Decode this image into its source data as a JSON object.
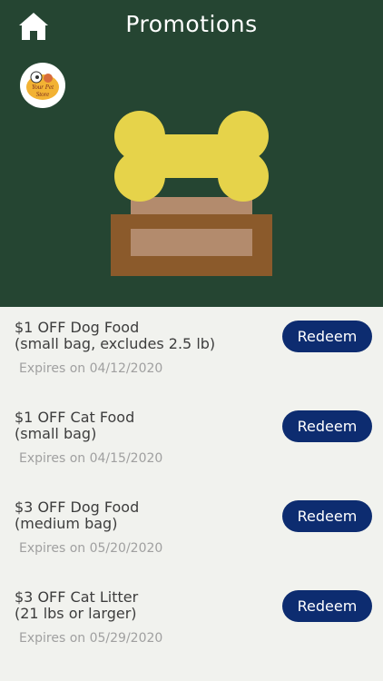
{
  "header": {
    "title": "Promotions",
    "home_icon": "home-icon",
    "logo_text": "Your Pet Store",
    "hero_image": "dog-bone-box",
    "colors": {
      "background": "#254532",
      "bone": "#e6d34a",
      "box": "#8b5a2b",
      "box_inner": "#b38b6d"
    }
  },
  "promotions": [
    {
      "title": "$1 OFF Dog Food\n(small bag, excludes 2.5 lb)",
      "expires": "Expires on 04/12/2020",
      "button": "Redeem"
    },
    {
      "title": "$1 OFF Cat Food\n(small bag)",
      "expires": "Expires on 04/15/2020",
      "button": "Redeem"
    },
    {
      "title": "$3 OFF Dog Food\n(medium bag)",
      "expires": "Expires on 05/20/2020",
      "button": "Redeem"
    },
    {
      "title": "$3 OFF Cat Litter\n(21 lbs or larger)",
      "expires": "Expires on 05/29/2020",
      "button": "Redeem"
    }
  ],
  "theme": {
    "list_background": "#f1f2ee",
    "button_color": "#0d2c70"
  }
}
